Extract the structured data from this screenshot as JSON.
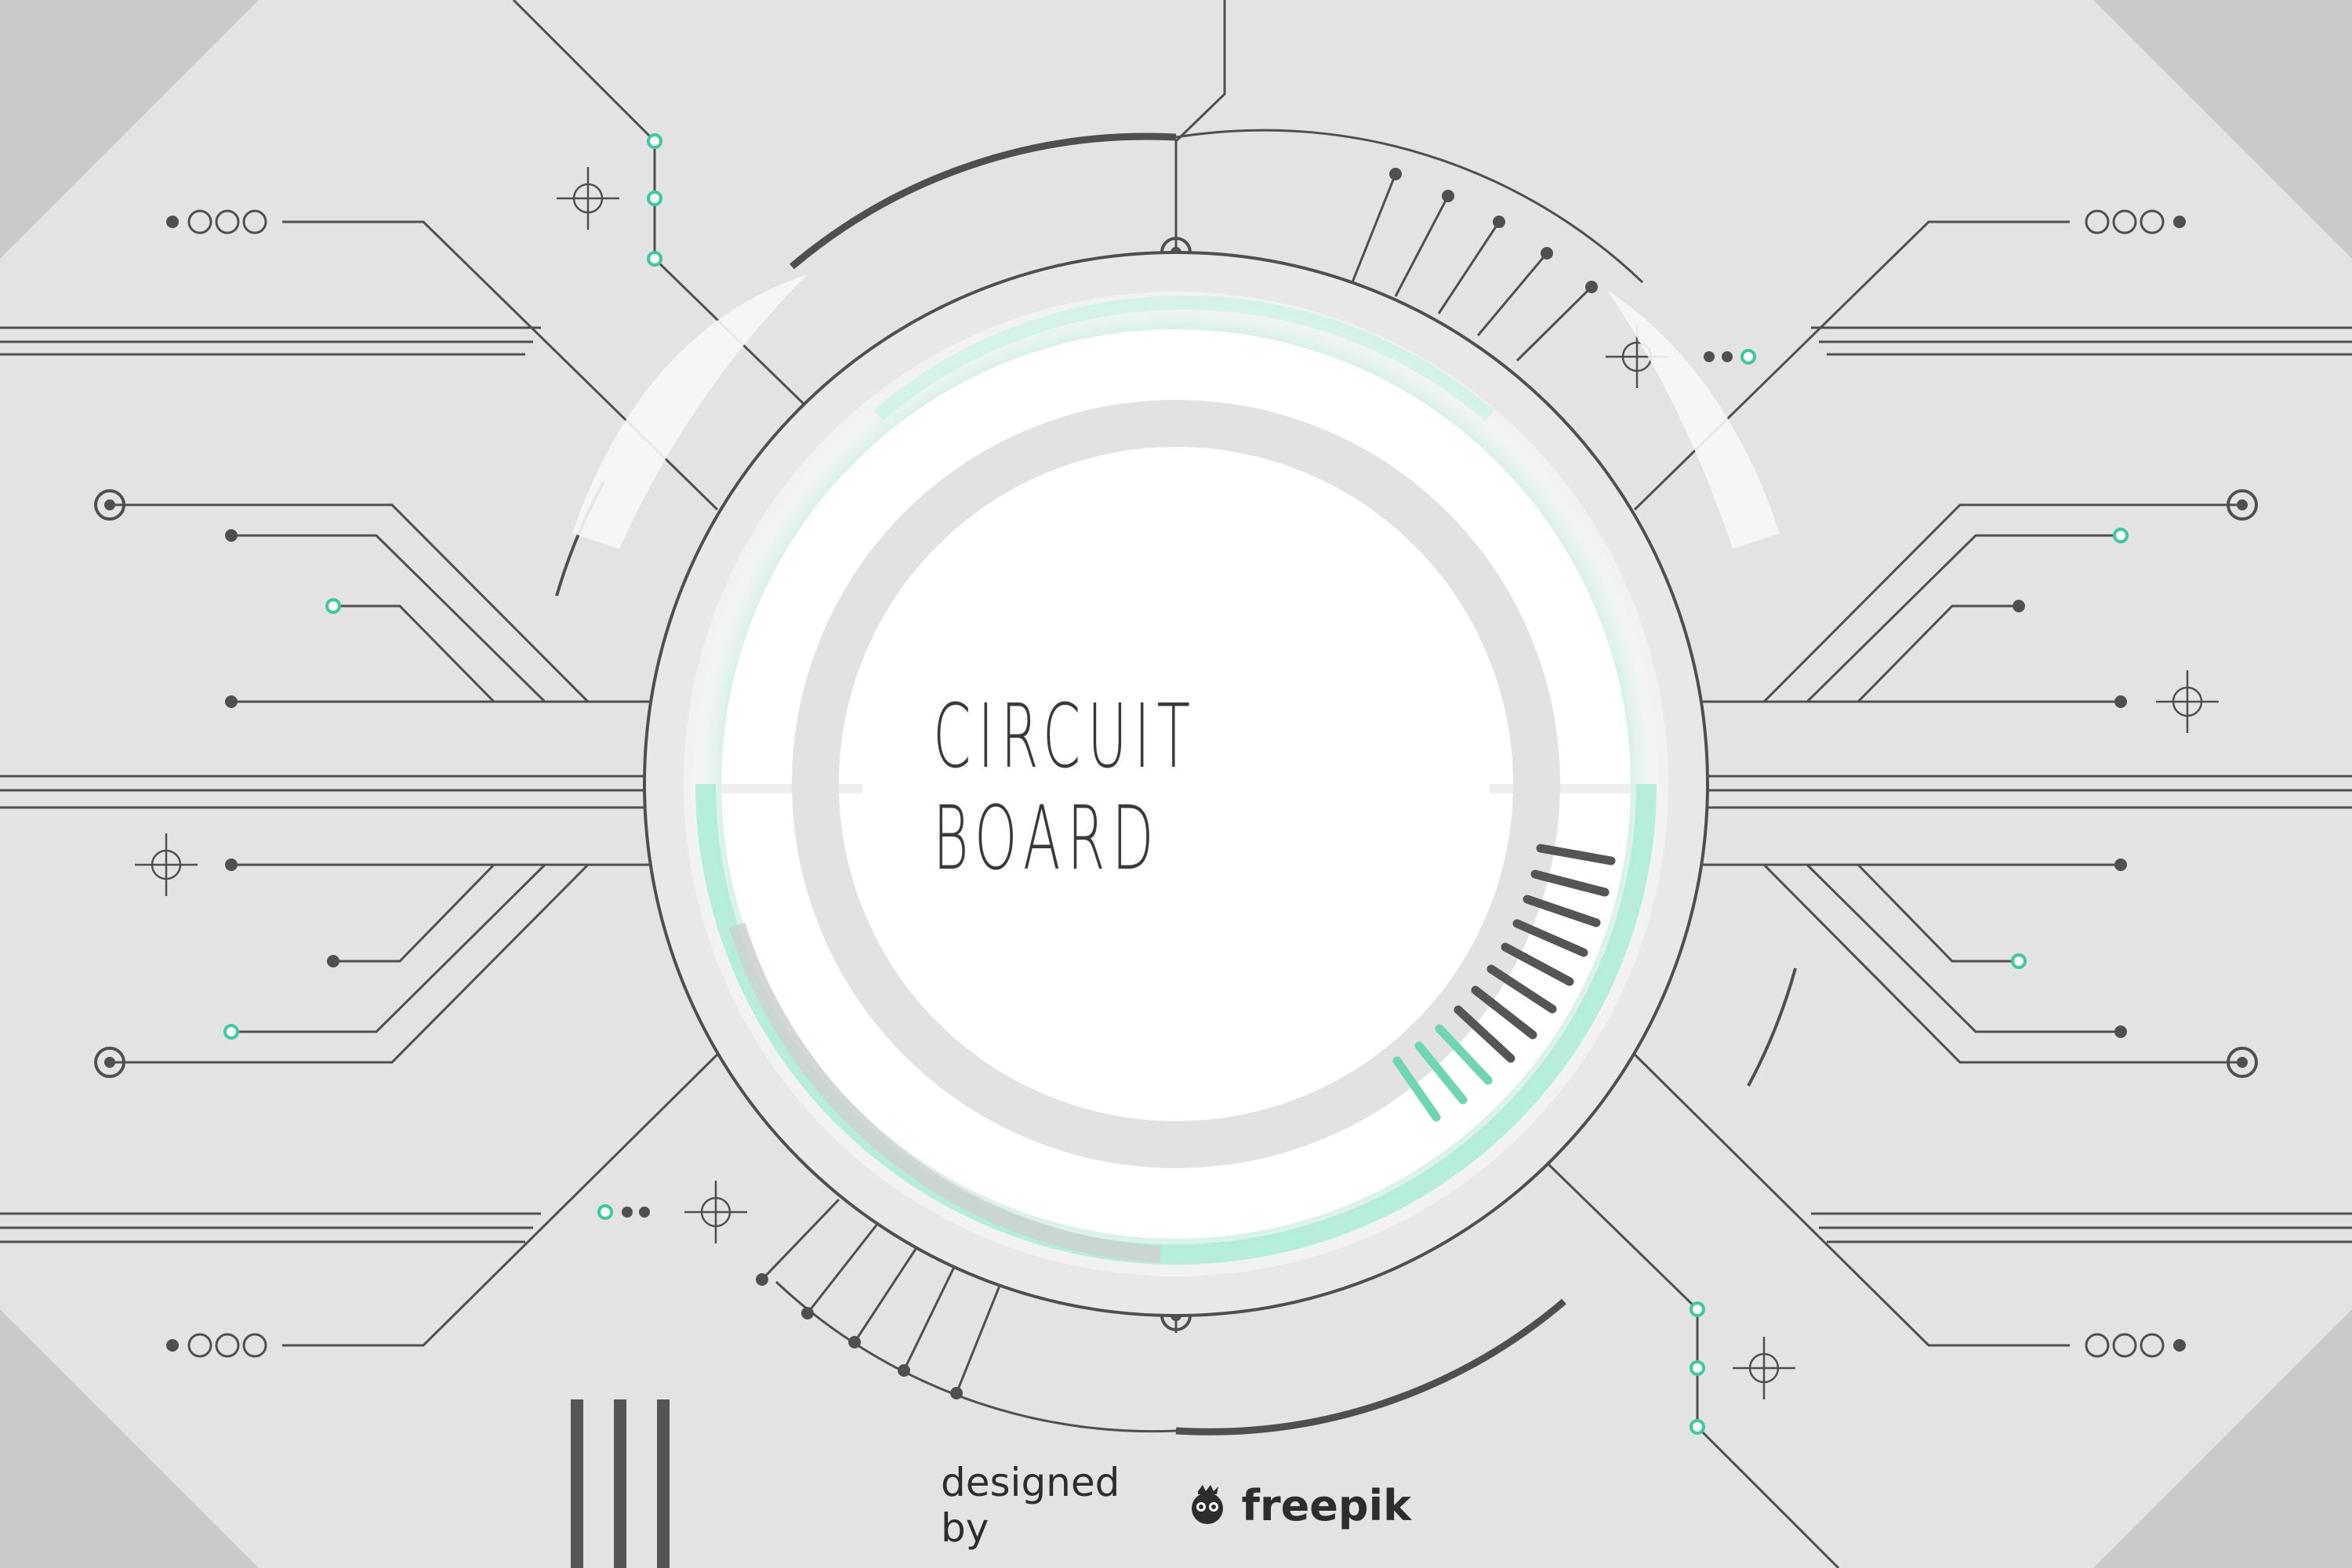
{
  "title": "CIRCUIT BOARD",
  "credit": {
    "prefix": "designed by",
    "brand": "freepik",
    "logo_icon": "freepik-logo-icon"
  },
  "colors": {
    "background": "#d6d6d6",
    "panel": "#e5e5e5",
    "line": "#4a4a4a",
    "accent": "#3cc9a0",
    "accent_glow": "#9ee8cf",
    "center": "#ffffff"
  }
}
